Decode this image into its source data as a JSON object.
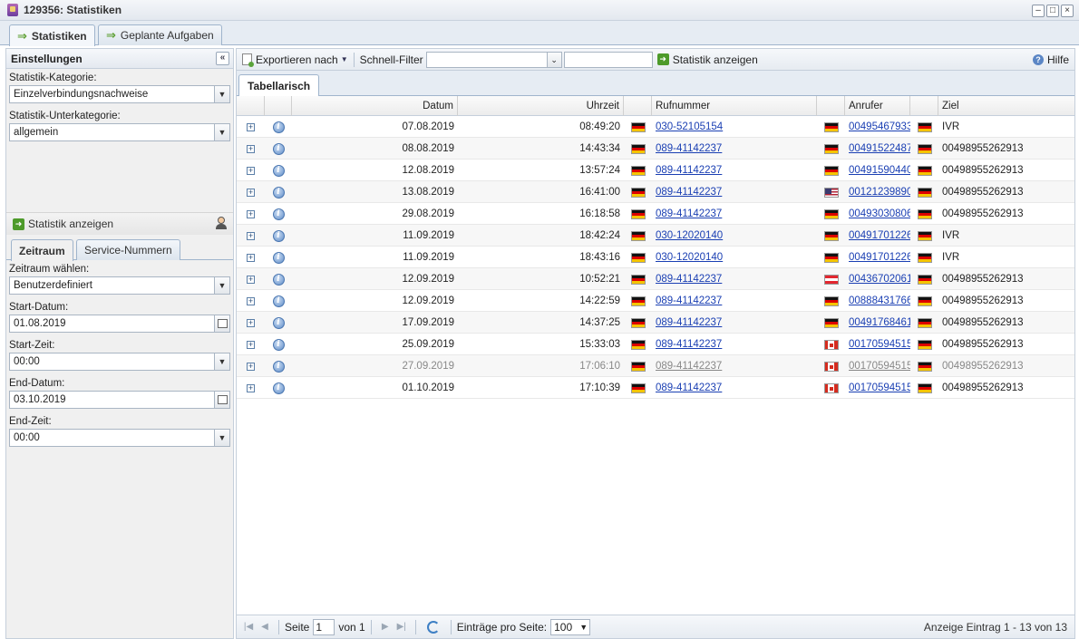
{
  "window": {
    "title": "129356: Statistiken",
    "minimize": "–",
    "maximize": "□",
    "close": "×"
  },
  "tabs": [
    {
      "label": "Statistiken",
      "icon": "arrow-right-icon"
    },
    {
      "label": "Geplante Aufgaben",
      "icon": "arrow-right-icon"
    }
  ],
  "settings": {
    "header": "Einstellungen",
    "category_label": "Statistik-Kategorie:",
    "category_value": "Einzelverbindungsnachweise",
    "subcategory_label": "Statistik-Unterkategorie:",
    "subcategory_value": "allgemein",
    "show_stats": "Statistik anzeigen",
    "subtabs": [
      "Zeitraum",
      "Service-Nummern"
    ],
    "period_label": "Zeitraum wählen:",
    "period_value": "Benutzerdefiniert",
    "start_date_label": "Start-Datum:",
    "start_date_value": "01.08.2019",
    "start_time_label": "Start-Zeit:",
    "start_time_value": "00:00",
    "end_date_label": "End-Datum:",
    "end_date_value": "03.10.2019",
    "end_time_label": "End-Zeit:",
    "end_time_value": "00:00"
  },
  "toolbar": {
    "export": "Exportieren nach",
    "filter_label": "Schnell-Filter",
    "show_stats": "Statistik anzeigen",
    "help": "Hilfe"
  },
  "grid": {
    "tab": "Tabellarisch",
    "columns": {
      "date": "Datum",
      "time": "Uhrzeit",
      "number": "Rufnummer",
      "caller": "Anrufer",
      "target": "Ziel"
    },
    "rows": [
      {
        "date": "07.08.2019",
        "time": "08:49:20",
        "number": "030-52105154",
        "caller_flag": "de",
        "caller": "00495467933",
        "target": "IVR"
      },
      {
        "date": "08.08.2019",
        "time": "14:43:34",
        "number": "089-41142237",
        "caller_flag": "de",
        "caller": "00491522487",
        "target": "00498955262913"
      },
      {
        "date": "12.08.2019",
        "time": "13:57:24",
        "number": "089-41142237",
        "caller_flag": "de",
        "caller": "00491590440",
        "target": "00498955262913"
      },
      {
        "date": "13.08.2019",
        "time": "16:41:00",
        "number": "089-41142237",
        "caller_flag": "us",
        "caller": "00121239890",
        "target": "00498955262913"
      },
      {
        "date": "29.08.2019",
        "time": "16:18:58",
        "number": "089-41142237",
        "caller_flag": "de",
        "caller": "00493030806",
        "target": "00498955262913"
      },
      {
        "date": "11.09.2019",
        "time": "18:42:24",
        "number": "030-12020140",
        "caller_flag": "de",
        "caller": "00491701226",
        "target": "IVR"
      },
      {
        "date": "11.09.2019",
        "time": "18:43:16",
        "number": "030-12020140",
        "caller_flag": "de",
        "caller": "00491701226",
        "target": "IVR"
      },
      {
        "date": "12.09.2019",
        "time": "10:52:21",
        "number": "089-41142237",
        "caller_flag": "at",
        "caller": "00436702061",
        "target": "00498955262913"
      },
      {
        "date": "12.09.2019",
        "time": "14:22:59",
        "number": "089-41142237",
        "caller_flag": "de",
        "caller": "00888431766",
        "target": "00498955262913"
      },
      {
        "date": "17.09.2019",
        "time": "14:37:25",
        "number": "089-41142237",
        "caller_flag": "de",
        "caller": "00491768461",
        "target": "00498955262913"
      },
      {
        "date": "25.09.2019",
        "time": "15:33:03",
        "number": "089-41142237",
        "caller_flag": "ca",
        "caller": "00170594515",
        "target": "00498955262913"
      },
      {
        "date": "27.09.2019",
        "time": "17:06:10",
        "number": "089-41142237",
        "caller_flag": "ca",
        "caller": "00170594515",
        "target": "00498955262913",
        "disabled": true
      },
      {
        "date": "01.10.2019",
        "time": "17:10:39",
        "number": "089-41142237",
        "caller_flag": "ca",
        "caller": "00170594515",
        "target": "00498955262913"
      }
    ]
  },
  "pager": {
    "page_label": "Seite",
    "page_value": "1",
    "of_label": "von 1",
    "per_page_label": "Einträge pro Seite:",
    "per_page_value": "100",
    "info": "Anzeige Eintrag 1 - 13 von 13"
  }
}
